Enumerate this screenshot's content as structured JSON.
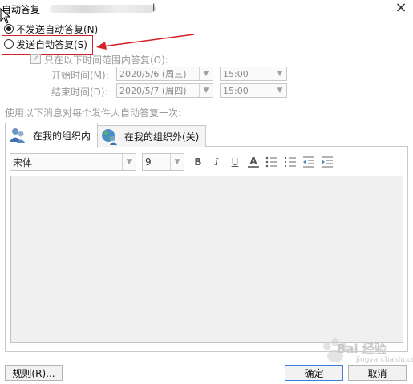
{
  "window": {
    "title": "自动答复 - ",
    "title_tail": "l",
    "close_glyph": "×"
  },
  "options": {
    "no_auto_reply": "不发送自动答复(N)",
    "send_auto_reply": "发送自动答复(S)",
    "selected": "no_auto_reply"
  },
  "time_range": {
    "checkbox_label": "只在以下时间范围内答复(O):",
    "checked": true,
    "start_label": "开始时间(M):",
    "start_date": "2020/5/6 (周三)",
    "start_time": "15:00",
    "end_label": "结束时间(D):",
    "end_date": "2020/5/7 (周四)",
    "end_time": "15:00"
  },
  "instruction": "使用以下消息对每个发件人自动答复一次:",
  "tabs": [
    {
      "label": "在我的组织内",
      "active": true
    },
    {
      "label": "在我的组织外(关)",
      "active": false
    }
  ],
  "format_toolbar": {
    "font_name": "宋体",
    "font_size": "9",
    "bold": "B",
    "italic": "I",
    "underline": "U",
    "font_color": "A"
  },
  "buttons": {
    "rules": "规则(R)...",
    "ok": "确定",
    "cancel": "取消"
  },
  "watermark": {
    "text": "Bai 经验",
    "url": "jingyan.baidu.com"
  },
  "colors": {
    "highlight": "#d4212a",
    "default_button_border": "#3c7fd8"
  }
}
